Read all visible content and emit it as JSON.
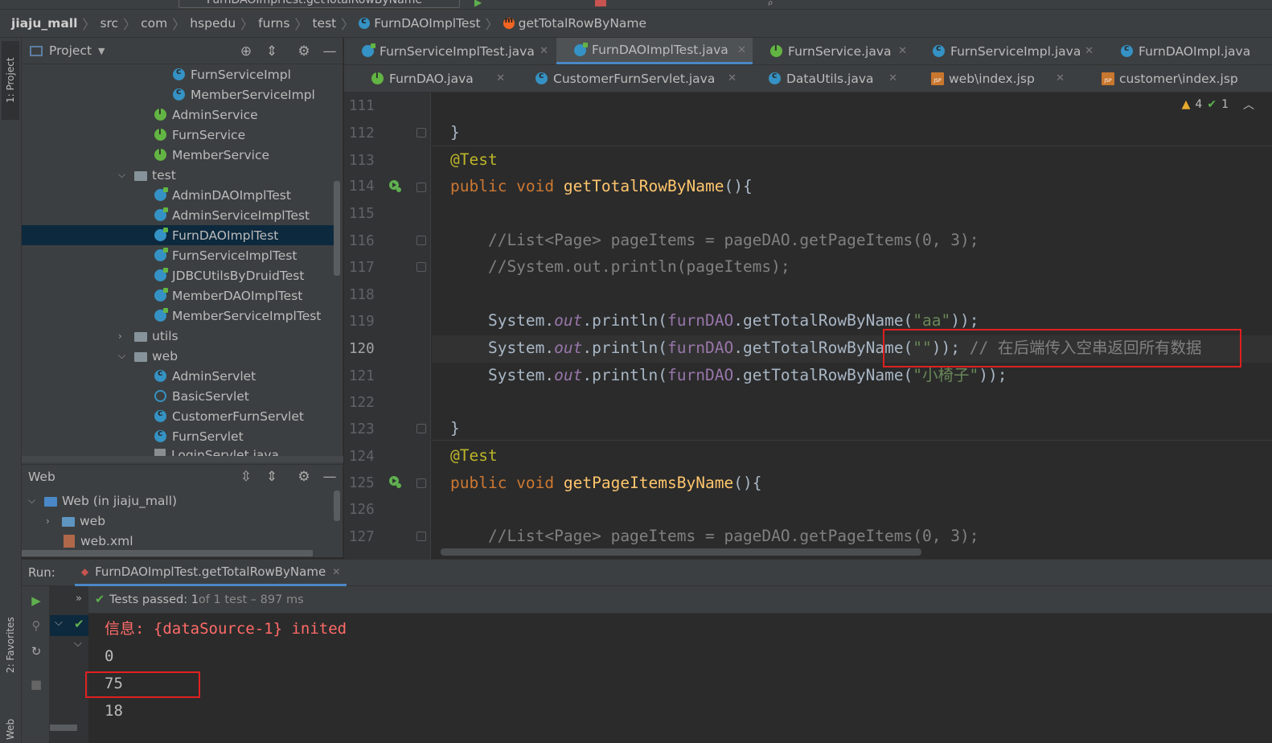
{
  "toolbar": {
    "run_config": "FurnDAOImplTest.getTotalRowByName"
  },
  "breadcrumb": [
    "jiaju_mall",
    "src",
    "com",
    "hspedu",
    "furns",
    "test",
    "FurnDAOImplTest",
    "getTotalRowByName"
  ],
  "left_strip": {
    "project_tab": "1: Project",
    "favorites_tab": "2: Favorites",
    "web_tab": "Web"
  },
  "project": {
    "title": "Project",
    "tree": [
      {
        "label": "FurnServiceImpl",
        "icon": "class-icon"
      },
      {
        "label": "MemberServiceImpl",
        "icon": "class-icon"
      },
      {
        "label": "AdminService",
        "icon": "interface-icon"
      },
      {
        "label": "FurnService",
        "icon": "interface-icon"
      },
      {
        "label": "MemberService",
        "icon": "interface-icon"
      },
      {
        "label": "test",
        "icon": "folder-icon"
      },
      {
        "label": "AdminDAOImplTest",
        "icon": "test-class-icon"
      },
      {
        "label": "AdminServiceImplTest",
        "icon": "test-class-icon"
      },
      {
        "label": "FurnDAOImplTest",
        "icon": "test-class-icon"
      },
      {
        "label": "FurnServiceImplTest",
        "icon": "test-class-icon"
      },
      {
        "label": "JDBCUtilsByDruidTest",
        "icon": "test-class-icon"
      },
      {
        "label": "MemberDAOImplTest",
        "icon": "test-class-icon"
      },
      {
        "label": "MemberServiceImplTest",
        "icon": "test-class-icon"
      },
      {
        "label": "utils",
        "icon": "folder-icon"
      },
      {
        "label": "web",
        "icon": "folder-icon"
      },
      {
        "label": "AdminServlet",
        "icon": "class-icon"
      },
      {
        "label": "BasicServlet",
        "icon": "abstract-class-icon"
      },
      {
        "label": "CustomerFurnServlet",
        "icon": "class-icon"
      },
      {
        "label": "FurnServlet",
        "icon": "class-icon"
      },
      {
        "label": "LoginServlet.java",
        "icon": "java-file-icon"
      }
    ]
  },
  "web_panel": {
    "title": "Web",
    "tree": [
      "Web (in jiaju_mall)",
      "web",
      "web.xml"
    ]
  },
  "editor_tabs_row1": [
    {
      "label": "FurnServiceImplTest.java",
      "icon": "test-class-icon",
      "active": false
    },
    {
      "label": "FurnDAOImplTest.java",
      "icon": "test-class-icon",
      "active": true
    },
    {
      "label": "FurnService.java",
      "icon": "interface-icon",
      "active": false
    },
    {
      "label": "FurnServiceImpl.java",
      "icon": "class-icon",
      "active": false
    },
    {
      "label": "FurnDAOImpl.java",
      "icon": "class-icon",
      "active": false
    }
  ],
  "editor_tabs_row2": [
    {
      "label": "FurnDAO.java",
      "icon": "interface-icon"
    },
    {
      "label": "CustomerFurnServlet.java",
      "icon": "class-icon"
    },
    {
      "label": "DataUtils.java",
      "icon": "class-icon"
    },
    {
      "label": "web\\index.jsp",
      "icon": "jsp-icon"
    },
    {
      "label": "customer\\index.jsp",
      "icon": "jsp-icon"
    }
  ],
  "inspections": {
    "warnings": "4",
    "ok": "1"
  },
  "line_numbers": [
    "111",
    "112",
    "113",
    "114",
    "115",
    "116",
    "117",
    "118",
    "119",
    "120",
    "121",
    "122",
    "123",
    "124",
    "125",
    "126",
    "127"
  ],
  "code": {
    "l112": "}",
    "l113": "@Test",
    "l114_kw": "public void ",
    "l114_fn": "getTotalRowByName",
    "l114_rest": "(){",
    "l116": "    //List<Page> pageItems = pageDAO.getPageItems(0, 3);",
    "l117": "    //System.out.println(pageItems);",
    "l119_a": "    System.",
    "l119_b": "out",
    "l119_c": ".println(",
    "l119_d": "furnDAO",
    "l119_e": ".getTotalRowByName(",
    "l119_f": "\"aa\"",
    "l119_g": "));",
    "l120_f": "\"\"",
    "l120_g": "));",
    "l120_cm": " // 在后端传入空串返回所有数据",
    "l121_f": "\"小椅子\"",
    "l121_g": "));",
    "l123": "}",
    "l124": "@Test",
    "l125_fn": "getPageItemsByName",
    "l127": "    //List<Page> pageItems = pageDAO.getPageItems(0, 3);"
  },
  "run": {
    "label": "Run:",
    "tab": "FurnDAOImplTest.getTotalRowByName",
    "status_passed": "Tests passed: 1",
    "status_detail": " of 1 test – 897 ms",
    "output": [
      "信息: {dataSource-1} inited",
      "0",
      "75",
      "18"
    ]
  }
}
